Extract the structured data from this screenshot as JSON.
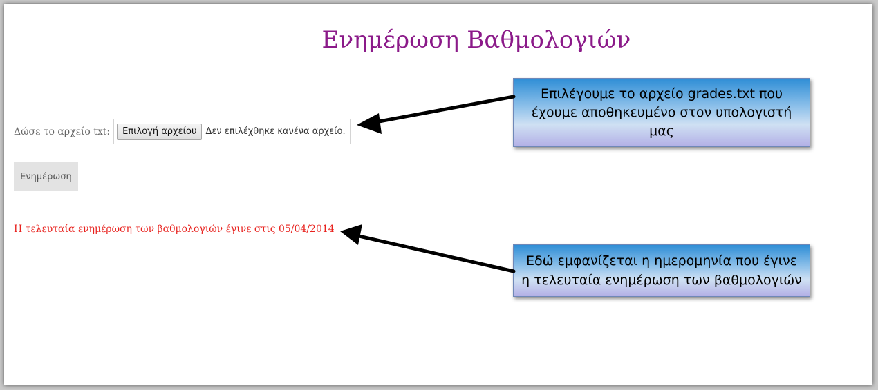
{
  "page": {
    "title": "Ενημέρωση Βαθμολογιών"
  },
  "form": {
    "file_label": "Δώσε το αρχείο txt:",
    "file_button_label": "Επιλογή αρχείου",
    "file_status": "Δεν επιλέχθηκε κανένα αρχείο.",
    "update_button_label": "Ενημέρωση"
  },
  "status": {
    "last_update_text": "Η τελευταία ενημέρωση των βαθμολογιών έγινε στις 05/04/2014"
  },
  "callouts": [
    {
      "lines": [
        "Επιλέγουμε το αρχείο grades.txt που",
        "έχουμε αποθηκευμένο στον υπολογιστή",
        "μας"
      ]
    },
    {
      "lines": [
        "Εδώ εμφανίζεται η ημερομηνία που έγινε",
        "η τελευταία ενημέρωση των βαθμολογιών"
      ]
    }
  ],
  "colors": {
    "title": "#8b1a89",
    "last_update": "#e8221e",
    "callout_top": "#2f8ed6",
    "callout_bottom": "#b3b0e6"
  }
}
